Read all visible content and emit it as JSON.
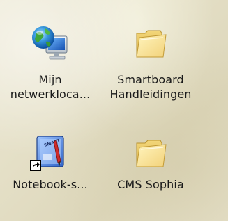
{
  "desktop": {
    "icons": [
      {
        "icon": "network-places-icon",
        "label_line1": "Mijn",
        "label_line2": "netwerkloca..."
      },
      {
        "icon": "folder-icon",
        "label_line1": "Smartboard",
        "label_line2": "Handleidingen"
      },
      {
        "icon": "smart-notebook-shortcut-icon",
        "label_line1": "Notebook-s..."
      },
      {
        "icon": "folder-icon",
        "label_line1": "CMS Sophia"
      }
    ]
  }
}
